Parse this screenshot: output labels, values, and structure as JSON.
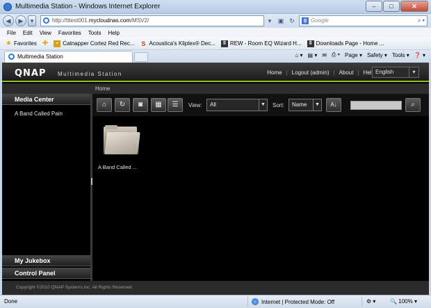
{
  "window": {
    "title": "Multimedia Station - Windows Internet Explorer",
    "minimize": "–",
    "maximize": "□",
    "close": "✕"
  },
  "address": {
    "url_prefix": "http://tttest001.",
    "url_domain": "mycloudnas.com",
    "url_suffix": "/MSV2/",
    "search_placeholder": "Google"
  },
  "menu": [
    "File",
    "Edit",
    "View",
    "Favorites",
    "Tools",
    "Help"
  ],
  "favorites": {
    "label": "Favorites",
    "items": [
      {
        "label": "Catnapper Cortez Red Rec...",
        "icon_color": "#d6a21a"
      },
      {
        "label": "Acoustica's Kliptex® Dec...",
        "icon_color": "#d52a1a"
      },
      {
        "label": "REW - Room EQ Wizard H...",
        "icon_color": "#333333"
      },
      {
        "label": "Downloads Page - Home ...",
        "icon_color": "#333333"
      }
    ]
  },
  "tab": {
    "label": "Multimedia Station"
  },
  "commands": [
    "Page ▾",
    "Safety ▾",
    "Tools ▾",
    "❓ ▾"
  ],
  "qnap": {
    "logo": "QNAP",
    "subtitle": "Multimedia Station",
    "nav": [
      "Home",
      "Logout (admin)",
      "About",
      "Help"
    ],
    "language": "English",
    "breadcrumb": "Home",
    "sidebar": {
      "media_center": "Media Center",
      "items": [
        "A Band Called Pain"
      ],
      "my_jukebox": "My Jukebox",
      "control_panel": "Control Panel"
    },
    "toolbar": {
      "view_label": "View:",
      "view_value": "All",
      "sort_label": "Sort:",
      "sort_value": "Name"
    },
    "folders": [
      {
        "label": "A Band Called ..."
      }
    ],
    "footer": "Copyright ©2010 QNAP Systems,Inc. All Rights Reserved."
  },
  "status": {
    "left": "Done",
    "zone": "Internet | Protected Mode: Off",
    "zoom": "100%"
  },
  "colors": {
    "accent": "#8fc21a",
    "app_bg": "#000000"
  }
}
